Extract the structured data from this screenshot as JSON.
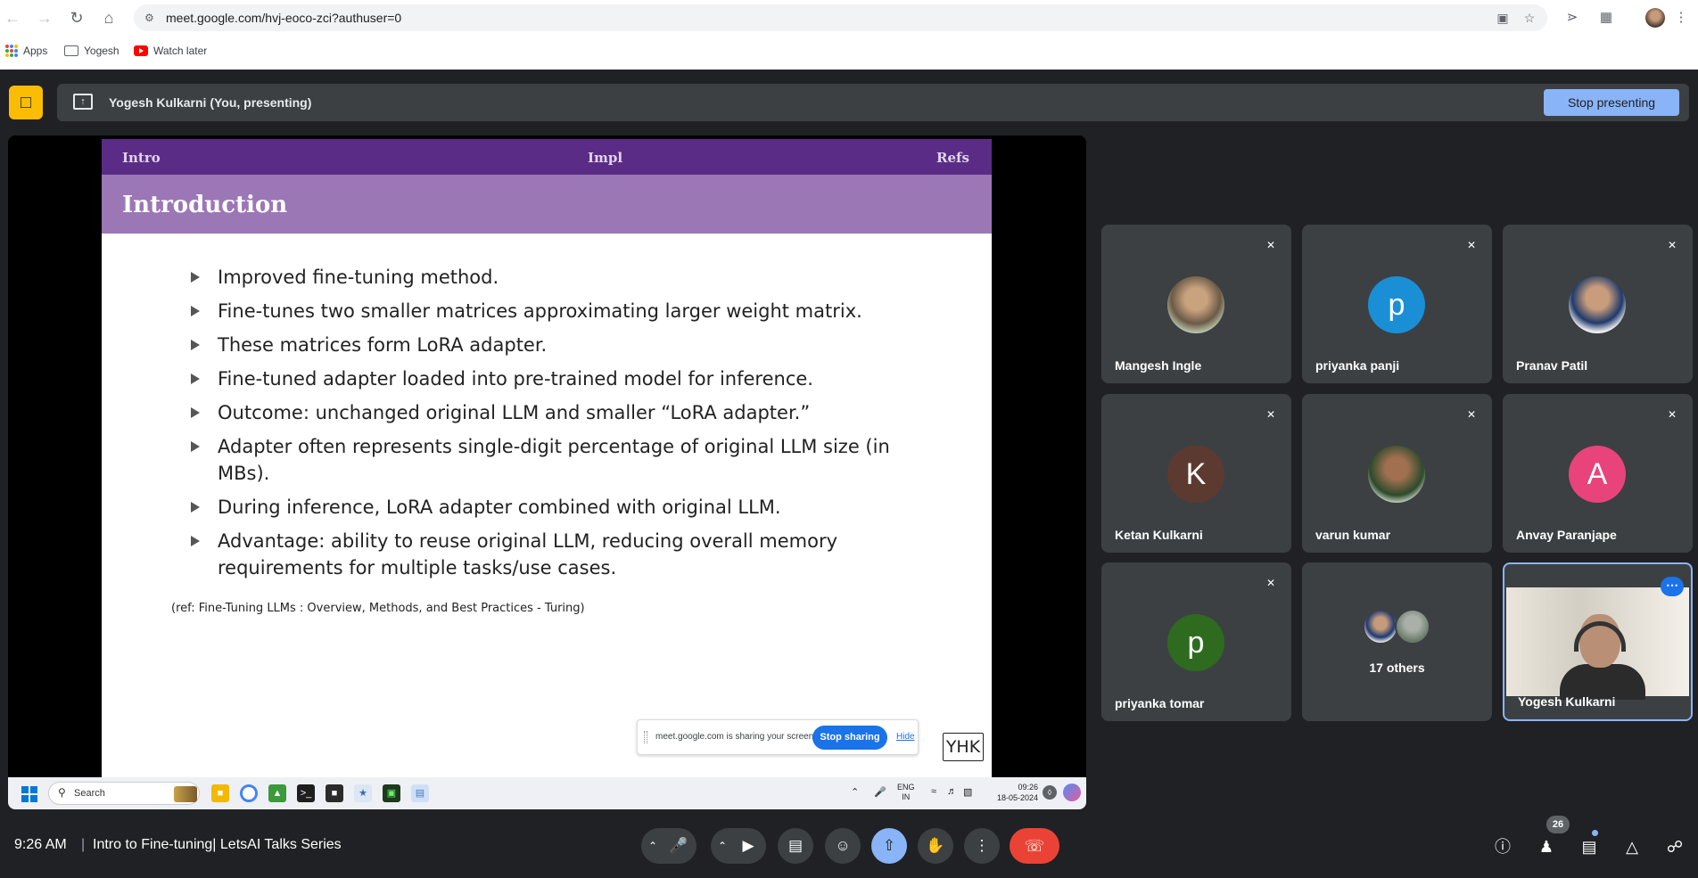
{
  "browser": {
    "url": "meet.google.com/hvj-eoco-zci?authuser=0",
    "bookmarks": [
      "Apps",
      "Yogesh",
      "Watch later"
    ]
  },
  "meet_top": {
    "presenter_label": "Yogesh Kulkarni (You, presenting)",
    "stop_presenting": "Stop presenting"
  },
  "slide": {
    "nav": [
      "Intro",
      "Impl",
      "Refs"
    ],
    "title": "Introduction",
    "bullets": [
      "Improved fine-tuning method.",
      "Fine-tunes two smaller matrices approximating larger weight matrix.",
      "These matrices form LoRA adapter.",
      "Fine-tuned adapter loaded into pre-trained model for inference.",
      "Outcome:  unchanged original LLM and smaller “LoRA adapter.”",
      "Adapter often represents single-digit percentage of original LLM size (in MBs).",
      "During inference, LoRA adapter combined with original LLM.",
      "Advantage:  ability to reuse original LLM, reducing overall memory requirements for multiple tasks/use cases."
    ],
    "ref": "(ref:  Fine-Tuning LLMs : Overview, Methods, and Best Practices - Turing)",
    "logo": "YHK"
  },
  "share_notice": {
    "message": "meet.google.com is sharing your screen.",
    "stop_sharing": "Stop sharing",
    "hide": "Hide"
  },
  "taskbar": {
    "search": "Search",
    "lang": "ENG",
    "region": "IN",
    "time": "09:26",
    "date": "18-05-2024"
  },
  "participants": [
    {
      "name": "Mangesh Ingle",
      "initial": "",
      "color": ""
    },
    {
      "name": "priyanka panji",
      "initial": "p",
      "color": "#1a8fd6"
    },
    {
      "name": "Pranav Patil",
      "initial": "",
      "color": ""
    },
    {
      "name": "Ketan Kulkarni",
      "initial": "K",
      "color": "#5d3a30"
    },
    {
      "name": "varun kumar",
      "initial": "",
      "color": ""
    },
    {
      "name": "Anvay Paranjape",
      "initial": "A",
      "color": "#e8437a"
    },
    {
      "name": "priyanka tomar",
      "initial": "p",
      "color": "#2e6b1f"
    }
  ],
  "others": {
    "label": "17 others"
  },
  "self_tile": {
    "name": "Yogesh Kulkarni"
  },
  "bottom_bar": {
    "time": "9:26 AM",
    "separator": "|",
    "title": "Intro to Fine-tuning| LetsAI Talks Series",
    "people_count": "26"
  }
}
